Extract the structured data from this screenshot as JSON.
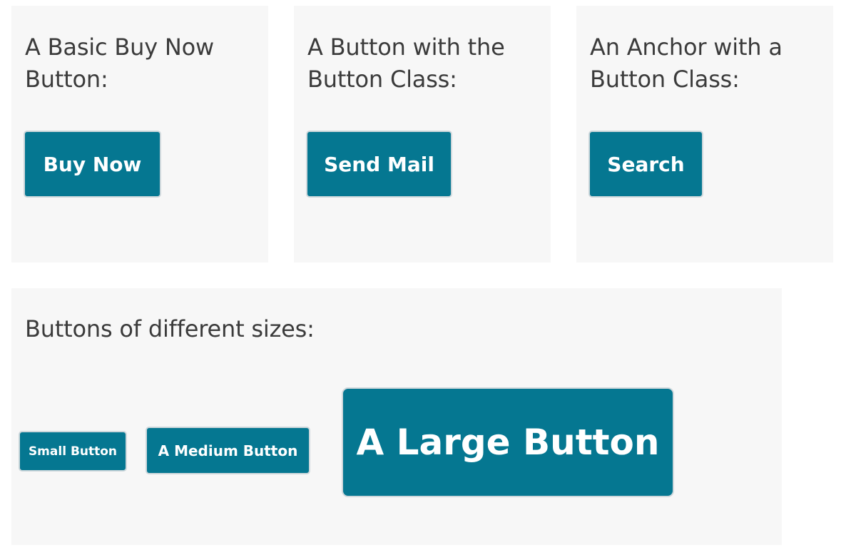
{
  "panels": {
    "basic": {
      "title": "A Basic Buy Now Button:",
      "button_label": "Buy Now"
    },
    "button_class": {
      "title": "A Button with the Button Class:",
      "button_label": "Send Mail"
    },
    "anchor_class": {
      "title": "An Anchor with a Button Class:",
      "button_label": "Search"
    },
    "sizes": {
      "title": "Buttons of different sizes:",
      "small_label": "Small Button",
      "medium_label": "A Medium Button",
      "large_label": "A Large Button"
    }
  },
  "colors": {
    "panel_background": "#f7f7f7",
    "button_background": "#057791",
    "button_text": "#ffffff",
    "button_border": "#cfd8dc",
    "heading_text": "#3b3b3b"
  }
}
